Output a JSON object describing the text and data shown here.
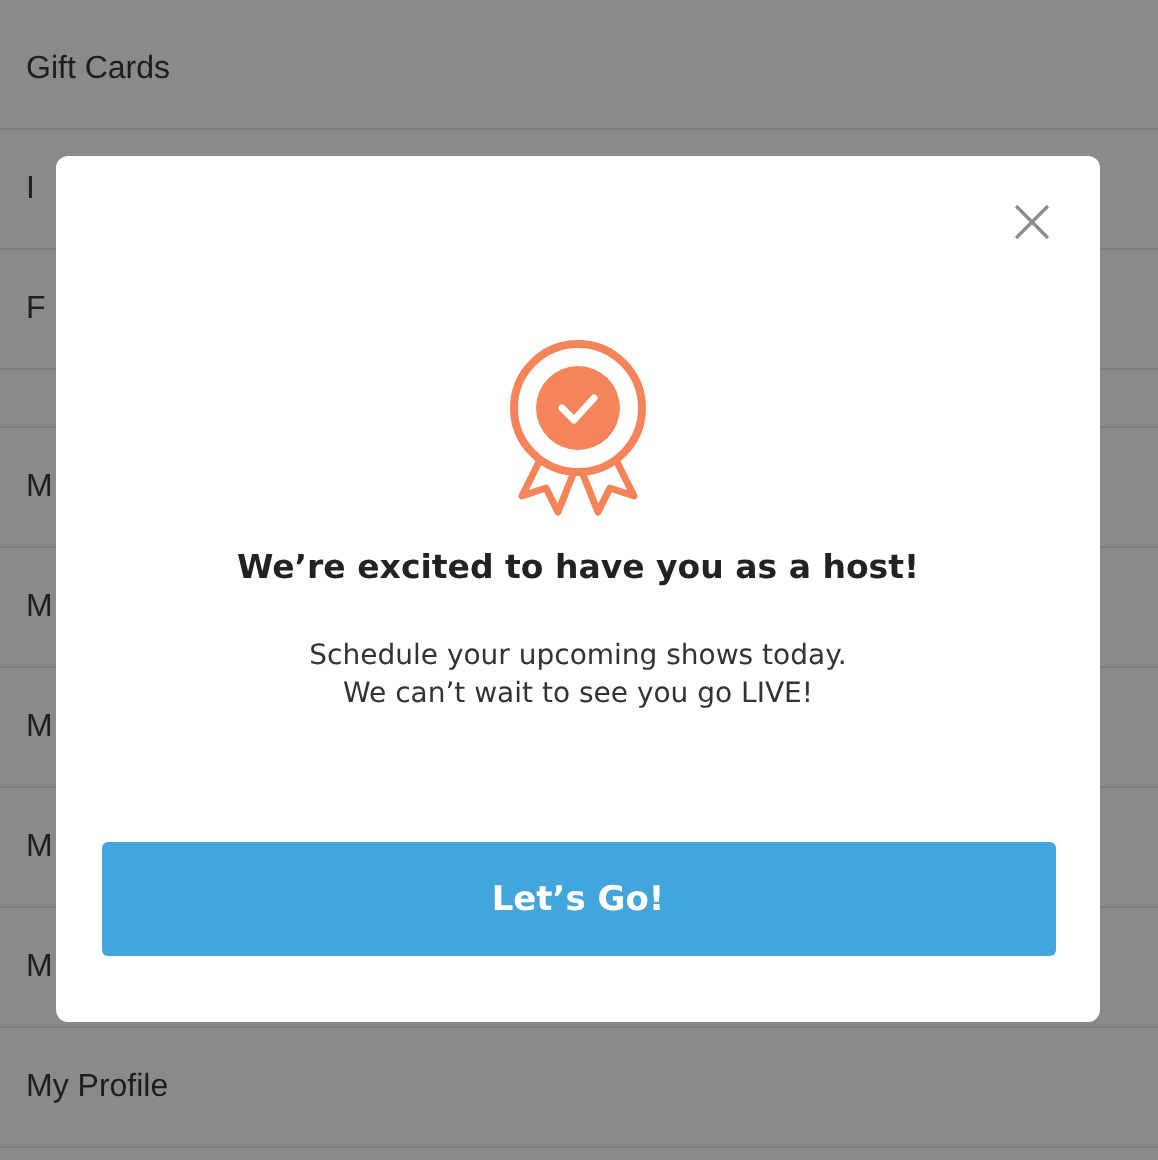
{
  "menu": {
    "sections": [
      {
        "items": [
          "Gift Cards",
          "I",
          "F"
        ]
      },
      {
        "items": [
          "M",
          "M",
          "M",
          "M",
          "M",
          "My Profile"
        ]
      }
    ]
  },
  "dialog": {
    "title": "We’re excited to have you as a host!",
    "message": [
      "Schedule your upcoming shows today.",
      "We can’t wait to see you go LIVE!"
    ],
    "button": "Let’s Go!"
  }
}
